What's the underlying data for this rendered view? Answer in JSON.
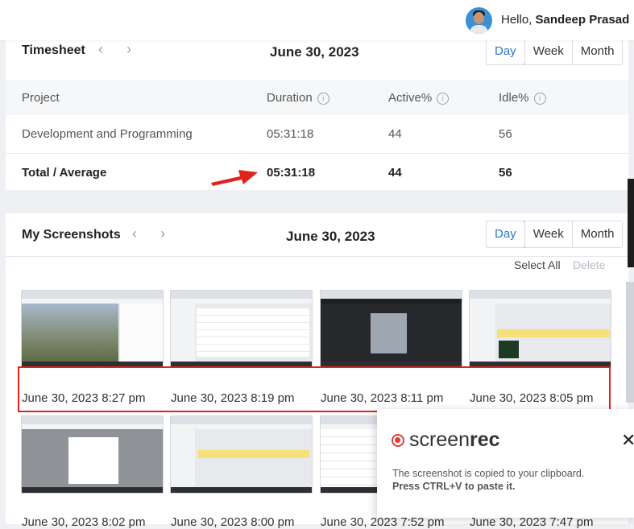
{
  "header": {
    "greeting_prefix": "Hello,",
    "user_name": "Sandeep Prasad"
  },
  "timesheet": {
    "title": "Timesheet",
    "date": "June 30, 2023",
    "views": [
      "Day",
      "Week",
      "Month"
    ],
    "active_view": "Day",
    "columns": [
      "Project",
      "Duration",
      "Active%",
      "Idle%"
    ],
    "rows": [
      {
        "project": "Development and Programming",
        "duration": "05:31:18",
        "active": "44",
        "idle": "56"
      }
    ],
    "total": {
      "label": "Total / Average",
      "duration": "05:31:18",
      "active": "44",
      "idle": "56"
    }
  },
  "screenshots": {
    "title": "My Screenshots",
    "date": "June 30, 2023",
    "views": [
      "Day",
      "Week",
      "Month"
    ],
    "active_view": "Day",
    "select_all": "Select All",
    "delete": "Delete",
    "items": [
      {
        "time": "June 30, 2023 8:27 pm"
      },
      {
        "time": "June 30, 2023 8:19 pm"
      },
      {
        "time": "June 30, 2023 8:11 pm"
      },
      {
        "time": "June 30, 2023 8:05 pm"
      },
      {
        "time": "June 30, 2023 8:02 pm"
      },
      {
        "time": "June 30, 2023 8:00 pm"
      },
      {
        "time": "June 30, 2023 7:52 pm"
      },
      {
        "time": "June 30, 2023 7:47 pm"
      }
    ]
  },
  "toast": {
    "brand_prefix": "screen",
    "brand_suffix": "rec",
    "message": "The screenshot is copied to your clipboard.",
    "hint": "Press CTRL+V to paste it."
  },
  "colors": {
    "accent": "#2a77c8",
    "annotation_red": "#e0241d",
    "brand_red": "#e13b3b"
  }
}
